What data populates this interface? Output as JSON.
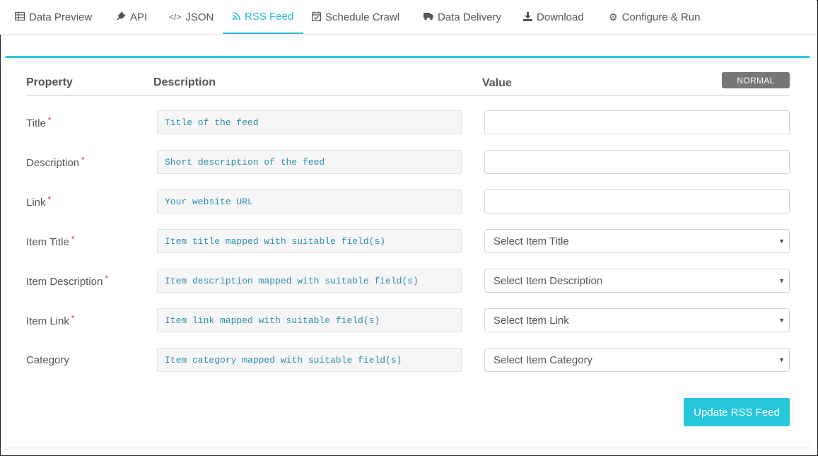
{
  "tabs": [
    {
      "label": "Data Preview",
      "icon": "table-icon"
    },
    {
      "label": "API",
      "icon": "plug-icon"
    },
    {
      "label": "JSON",
      "icon": "code-icon"
    },
    {
      "label": "RSS Feed",
      "icon": "rss-icon"
    },
    {
      "label": "Schedule Crawl",
      "icon": "calendar-check-icon"
    },
    {
      "label": "Data Delivery",
      "icon": "truck-icon"
    },
    {
      "label": "Download",
      "icon": "download-icon"
    },
    {
      "label": "Configure & Run",
      "icon": "gear-icon"
    }
  ],
  "active_tab": "RSS Feed",
  "headers": {
    "property": "Property",
    "description": "Description",
    "value": "Value"
  },
  "mode_badge": "NORMAL",
  "rows": [
    {
      "property": "Title",
      "required": true,
      "description": "Title of the feed",
      "value": "",
      "type": "text"
    },
    {
      "property": "Description",
      "required": true,
      "description": "Short description of the feed",
      "value": "",
      "type": "text"
    },
    {
      "property": "Link",
      "required": true,
      "description": "Your website URL",
      "value": "",
      "type": "text"
    },
    {
      "property": "Item Title",
      "required": true,
      "description": "Item title mapped with suitable field(s)",
      "value": "Select Item Title",
      "type": "select"
    },
    {
      "property": "Item Description",
      "required": true,
      "description": "Item description mapped with suitable field(s)",
      "value": "Select Item Description",
      "type": "select"
    },
    {
      "property": "Item Link",
      "required": true,
      "description": "Item link mapped with suitable field(s)",
      "value": "Select Item Link",
      "type": "select"
    },
    {
      "property": "Category",
      "required": false,
      "description": "Item category mapped with suitable field(s)",
      "value": "Select Item Category",
      "type": "select"
    }
  ],
  "required_marker": "*",
  "dropdown_arrow": "▼",
  "update_button": "Update RSS Feed",
  "colors": {
    "accent": "#26c6dc",
    "required": "#e03030",
    "badge": "#777777",
    "desc_text": "#2a8fb0"
  }
}
